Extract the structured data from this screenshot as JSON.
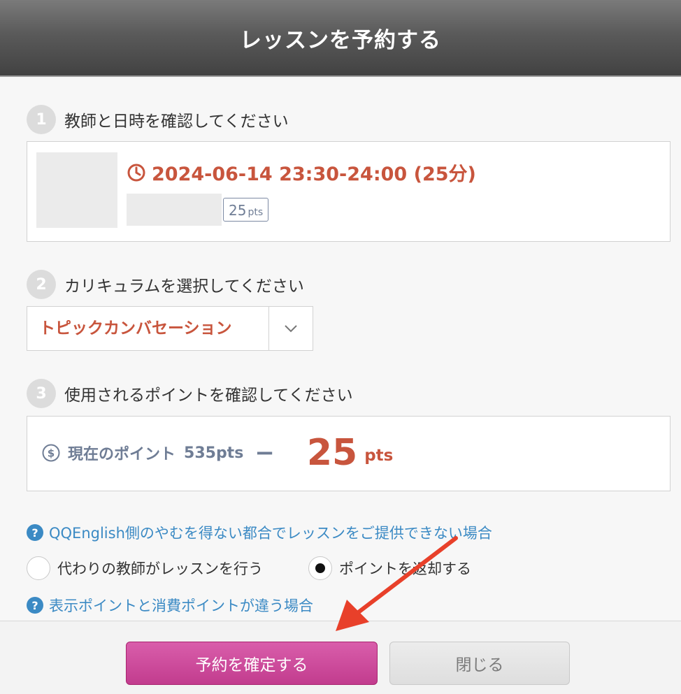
{
  "header": {
    "title": "レッスンを予約する"
  },
  "step1": {
    "number": "1",
    "label": "教師と日時を確認してください",
    "lesson_datetime": "2024-06-14 23:30-24:00 (25分)",
    "teacher_points": "25",
    "teacher_points_unit": "pts"
  },
  "step2": {
    "number": "2",
    "label": "カリキュラムを選択してください",
    "selected_curriculum": "トピックカンバセーション"
  },
  "step3": {
    "number": "3",
    "label": "使用されるポイントを確認してください",
    "current_points_label": "現在のポイント",
    "current_points_value": "535pts",
    "minus_sign": "−",
    "cost_value": "25",
    "cost_unit": "pts"
  },
  "cancellation": {
    "help_link_text": "QQEnglish側のやむを得ない都合でレッスンをご提供できない場合",
    "options": [
      {
        "label": "代わりの教師がレッスンを行う",
        "selected": false
      },
      {
        "label": "ポイントを返却する",
        "selected": true
      }
    ],
    "help_link2_text": "表示ポイントと消費ポイントが違う場合"
  },
  "footer": {
    "confirm_label": "予約を確定する",
    "close_label": "閉じる"
  },
  "colors": {
    "accent_red": "#c8553d",
    "link_blue": "#3b8ac4",
    "confirm_pink": "#c23c8e",
    "annotation_arrow": "#e8402a"
  },
  "icons": {
    "clock": "clock-icon",
    "dollar": "dollar-circle-icon",
    "help": "question-circle-icon",
    "chevron": "chevron-down-icon"
  }
}
